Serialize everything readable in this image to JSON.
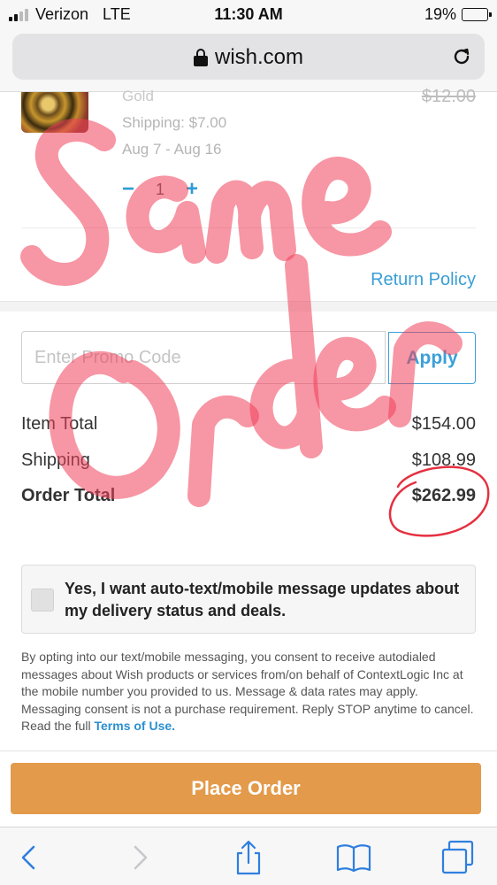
{
  "status_bar": {
    "carrier": "Verizon",
    "network": "LTE",
    "time": "11:30 AM",
    "battery_percent": "19%",
    "battery_level": 0.19,
    "battery_color": "#e53935"
  },
  "browser": {
    "url": "wish.com",
    "lock_icon": "lock-icon",
    "reload_icon": "reload-icon"
  },
  "product": {
    "variant": "Gold",
    "original_price": "$12.00",
    "shipping": "Shipping: $7.00",
    "delivery_dates": "Aug 7 - Aug 16",
    "quantity": "1",
    "minus": "−",
    "plus": "+"
  },
  "return_policy_label": "Return Policy",
  "promo": {
    "placeholder": "Enter Promo Code",
    "value": "",
    "apply_label": "Apply"
  },
  "totals": {
    "item_total_label": "Item Total",
    "item_total_value": "$154.00",
    "shipping_label": "Shipping",
    "shipping_value": "$108.99",
    "order_total_label": "Order Total",
    "order_total_value": "$262.99"
  },
  "optin": {
    "checked": false,
    "label": "Yes, I want auto-text/mobile message updates about my delivery status and deals."
  },
  "disclaimer": {
    "text": "By opting into our text/mobile messaging, you consent to receive autodialed messages about Wish products or services from/on behalf of ContextLogic Inc at the mobile number you provided to us. Message & data rates may apply. Messaging consent is not a purchase requirement. Reply STOP anytime to cancel. Read the full ",
    "terms_link": "Terms of Use."
  },
  "place_order_label": "Place Order",
  "toolbar": {
    "icons": [
      "back-icon",
      "forward-icon",
      "share-icon",
      "bookmarks-icon",
      "tabs-icon"
    ]
  },
  "annotation": {
    "handwritten_text": "Same Order",
    "color": "#f0405a"
  },
  "colors": {
    "accent_blue": "#3aa0d8",
    "place_order_orange": "#e39a4a"
  }
}
